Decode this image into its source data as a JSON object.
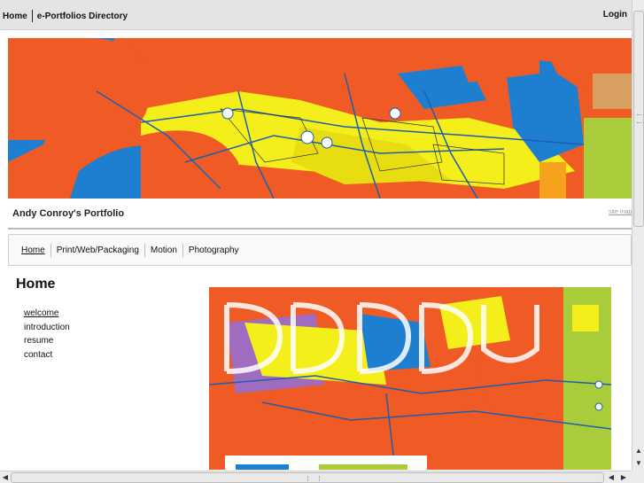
{
  "topbar": {
    "home": "Home",
    "directory": "e-Portfolios Directory",
    "login": "Login"
  },
  "site": {
    "title": "Andy Conroy's Portfolio",
    "sitemap": "site map"
  },
  "nav": {
    "tabs": [
      {
        "label": "Home",
        "active": true
      },
      {
        "label": "Print/Web/Packaging",
        "active": false
      },
      {
        "label": "Motion",
        "active": false
      },
      {
        "label": "Photography",
        "active": false
      }
    ]
  },
  "page": {
    "heading": "Home",
    "subnav": [
      {
        "label": "welcome",
        "active": true
      },
      {
        "label": "introduction",
        "active": false
      },
      {
        "label": "resume",
        "active": false
      },
      {
        "label": "contact",
        "active": false
      }
    ]
  },
  "colors": {
    "orange": "#f05a24",
    "blue": "#1e7fd0",
    "yellow": "#f4ee1a",
    "green": "#a9cc3a",
    "purple": "#a06cc0"
  },
  "icons": {
    "scroll_up": "▲",
    "scroll_down": "▼",
    "scroll_left": "◀",
    "scroll_right": "▶"
  }
}
